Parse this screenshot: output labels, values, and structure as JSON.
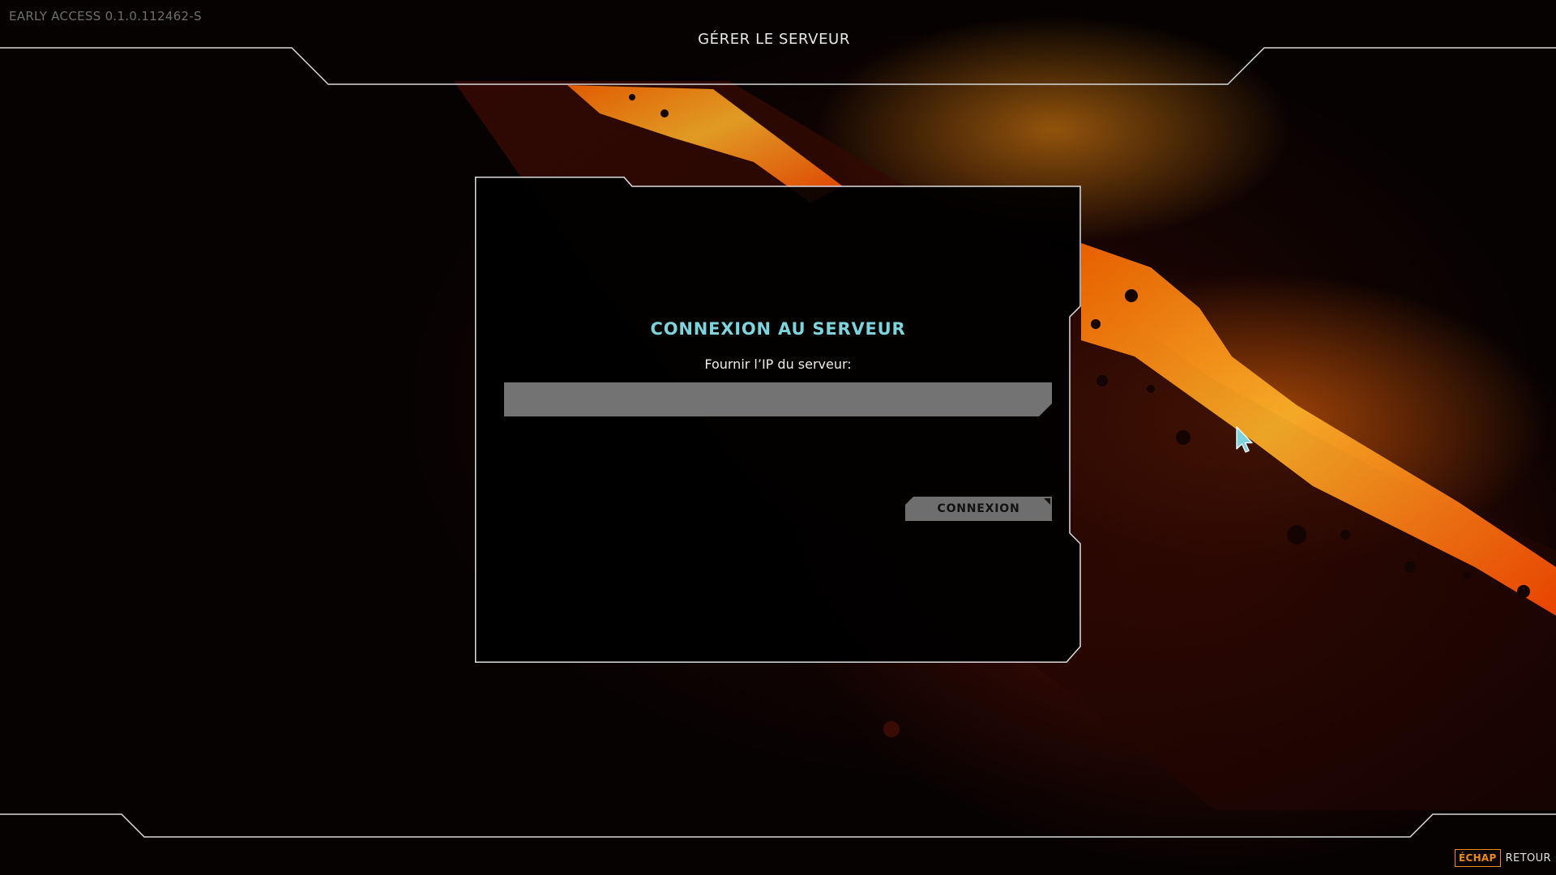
{
  "app": {
    "version_text": "EARLY ACCESS 0.1.0.112462-S",
    "page_title": "GÉRER LE SERVEUR"
  },
  "dialog": {
    "title": "CONNEXION AU SERVEUR",
    "label": "Fournir l’IP du serveur:",
    "ip_input": {
      "value": "",
      "placeholder": ""
    },
    "connect_label": "CONNEXION"
  },
  "footer": {
    "back_key": "ÉCHAP",
    "back_label": "RETOUR"
  },
  "colors": {
    "accent_cyan": "#7fd3dd",
    "accent_orange": "#f08a1c",
    "frame_line": "#d8d8d8",
    "input_bg": "#737373",
    "button_bg": "#6e6e6e"
  },
  "icons": {
    "cursor": "mouse-pointer-icon",
    "back_key": "key-badge"
  }
}
